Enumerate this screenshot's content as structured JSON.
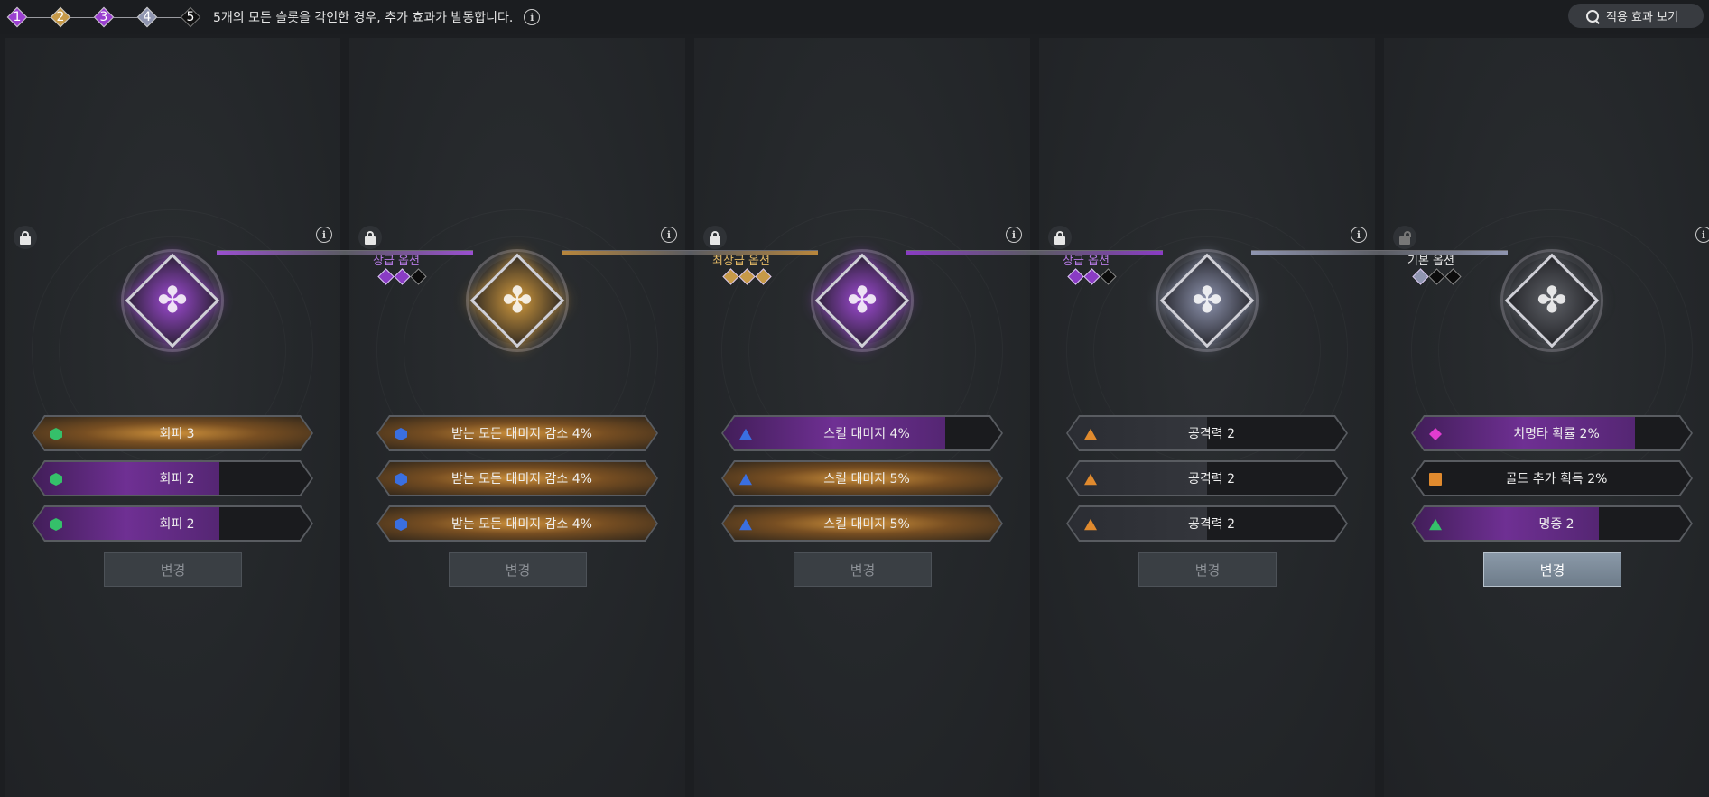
{
  "header": {
    "steps": [
      "1",
      "2",
      "3",
      "4",
      "5"
    ],
    "step_colors": [
      "#9a3fd0",
      "#c79a48",
      "#9a3fd0",
      "#8f95b0",
      "#111111"
    ],
    "notice": "5개의 모든 슬롯을 각인한 경우, 추가 효과가 발동합니다.",
    "view_effects": "적용 효과 보기"
  },
  "slots": [
    {
      "tier_label": "",
      "tier_color": "#c79ad8",
      "gems": [],
      "emblem_color": "#a04bd6",
      "locked": true,
      "options": [
        {
          "text": "회피 3",
          "icon": "hex",
          "icon_color": "#35c06a",
          "fill": "gold",
          "level": 1.0
        },
        {
          "text": "회피 2",
          "icon": "hex",
          "icon_color": "#35c06a",
          "fill": "purple",
          "level": 0.67
        },
        {
          "text": "회피 2",
          "icon": "hex",
          "icon_color": "#35c06a",
          "fill": "purple",
          "level": 0.67
        }
      ],
      "change_label": "변경",
      "change_active": false
    },
    {
      "tier_label": "상급 옵션",
      "tier_color": "#b77be6",
      "gems": [
        "#8a3cc4",
        "#8a3cc4",
        "#0c0c0c"
      ],
      "emblem_color": "#d39b3e",
      "locked": true,
      "options": [
        {
          "text": "받는 모든 대미지 감소 4%",
          "icon": "hex",
          "icon_color": "#3a6fe0",
          "fill": "gold",
          "level": 1.0
        },
        {
          "text": "받는 모든 대미지 감소 4%",
          "icon": "hex",
          "icon_color": "#3a6fe0",
          "fill": "gold",
          "level": 1.0
        },
        {
          "text": "받는 모든 대미지 감소 4%",
          "icon": "hex",
          "icon_color": "#3a6fe0",
          "fill": "gold",
          "level": 1.0
        }
      ],
      "change_label": "변경",
      "change_active": false
    },
    {
      "tier_label": "최상급 옵션",
      "tier_color": "#e2b866",
      "gems": [
        "#c79a48",
        "#c79a48",
        "#c79a48"
      ],
      "emblem_color": "#a04bd6",
      "locked": true,
      "options": [
        {
          "text": "스킬 대미지 4%",
          "icon": "tri",
          "icon_color": "#3a6fe0",
          "fill": "purple",
          "level": 0.8
        },
        {
          "text": "스킬 대미지 5%",
          "icon": "tri",
          "icon_color": "#3a6fe0",
          "fill": "gold",
          "level": 1.0
        },
        {
          "text": "스킬 대미지 5%",
          "icon": "tri",
          "icon_color": "#3a6fe0",
          "fill": "gold",
          "level": 1.0
        }
      ],
      "change_label": "변경",
      "change_active": false
    },
    {
      "tier_label": "상급 옵션",
      "tier_color": "#b77be6",
      "gems": [
        "#8a3cc4",
        "#8a3cc4",
        "#0c0c0c"
      ],
      "emblem_color": "#8f95b0",
      "locked": true,
      "options": [
        {
          "text": "공격력 2",
          "icon": "tri",
          "icon_color": "#e08a2e",
          "fill": "grey",
          "level": 0.5
        },
        {
          "text": "공격력 2",
          "icon": "tri",
          "icon_color": "#e08a2e",
          "fill": "grey",
          "level": 0.5
        },
        {
          "text": "공격력 2",
          "icon": "tri",
          "icon_color": "#e08a2e",
          "fill": "grey",
          "level": 0.5
        }
      ],
      "change_label": "변경",
      "change_active": false
    },
    {
      "tier_label": "기본 옵션",
      "tier_color": "#e8e8e8",
      "gems": [
        "#8f95b0",
        "#0c0c0c",
        "#0c0c0c"
      ],
      "emblem_color": "#5f6268",
      "locked": false,
      "options": [
        {
          "text": "치명타 확률 2%",
          "icon": "dia",
          "icon_color": "#e03ccf",
          "fill": "purple",
          "level": 0.8
        },
        {
          "text": "골드 추가 획득 2%",
          "icon": "sq",
          "icon_color": "#e08a2e",
          "fill": "none",
          "level": 0.0
        },
        {
          "text": "명중 2",
          "icon": "tri",
          "icon_color": "#35c06a",
          "fill": "purple",
          "level": 0.67
        }
      ],
      "change_label": "변경",
      "change_active": true
    }
  ],
  "info_symbol": "i",
  "knot_glyph": "✤"
}
